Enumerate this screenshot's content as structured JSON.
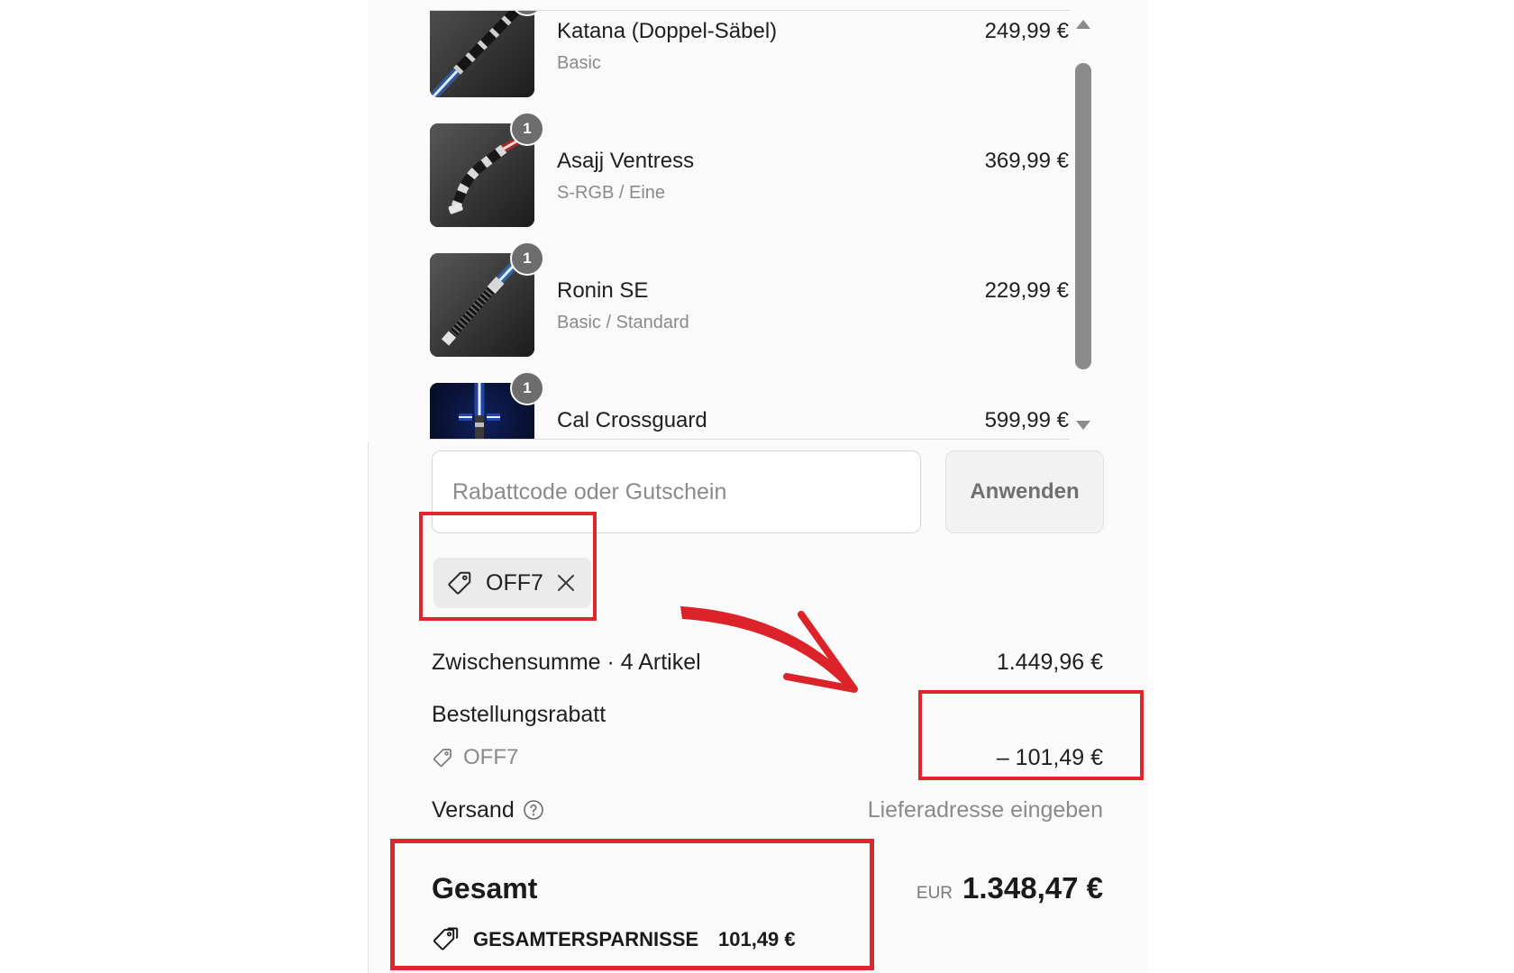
{
  "cart": {
    "items": [
      {
        "title": "Katana (Doppel-Säbel)",
        "variant": "Basic",
        "price": "249,99 €"
      },
      {
        "title": "Asajj Ventress",
        "variant": "S-RGB / Eine",
        "price": "369,99 €",
        "qty": "1"
      },
      {
        "title": "Ronin SE",
        "variant": "Basic / Standard",
        "price": "229,99 €",
        "qty": "1"
      },
      {
        "title": "Cal Crossguard",
        "price": "599,99 €",
        "qty": "1"
      }
    ]
  },
  "discount": {
    "placeholder": "Rabattcode oder Gutschein",
    "apply_label": "Anwenden",
    "applied_code": "OFF7"
  },
  "summary": {
    "subtotal_label": "Zwischensumme · 4 Artikel",
    "subtotal_value": "1.449,96 €",
    "order_discount_label": "Bestellungsrabatt",
    "order_discount_code": "OFF7",
    "order_discount_value": "– 101,49 €",
    "shipping_label": "Versand",
    "shipping_value": "Lieferadresse eingeben",
    "total_label": "Gesamt",
    "total_currency": "EUR",
    "total_value": "1.348,47 €",
    "savings_label": "GESAMTERSPARNISSE",
    "savings_value": "101,49 €"
  },
  "icons": {
    "coupon": "tag-icon",
    "remove_coupon": "close-icon",
    "shipping_help": "help-circle-icon",
    "savings": "double-tag-icon",
    "scroll_up": "triangle-up-icon",
    "scroll_down": "triangle-down-icon"
  },
  "colors": {
    "annotation_red": "#e0262d",
    "panel_background": "#fafafa",
    "text_primary": "#1f1f1f",
    "text_muted": "#8a8a8a",
    "badge": "#6d6d6d"
  }
}
